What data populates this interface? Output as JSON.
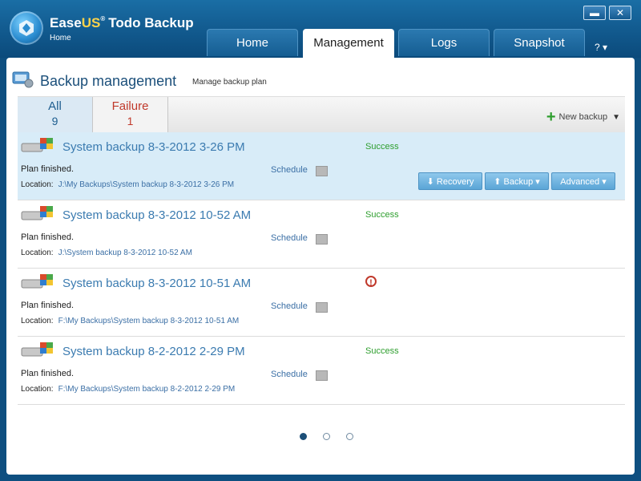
{
  "app": {
    "brand_ease": "Ease",
    "brand_us": "US",
    "brand_reg": "®",
    "brand_product": "Todo Backup",
    "home_label": "Home",
    "minimize_label": "▬",
    "close_label": "✕",
    "help_label": "? ▾"
  },
  "tabs": [
    {
      "label": "Home"
    },
    {
      "label": "Management"
    },
    {
      "label": "Logs"
    },
    {
      "label": "Snapshot"
    }
  ],
  "header": {
    "title": "Backup management",
    "subtitle": "Manage backup plan"
  },
  "filters": {
    "all_label": "All",
    "all_count": "9",
    "failure_label": "Failure",
    "failure_count": "1",
    "new_backup_label": "New backup"
  },
  "actions": {
    "recovery": "Recovery",
    "backup": "Backup",
    "advanced": "Advanced"
  },
  "backups": [
    {
      "name": "System backup 8-3-2012 3-26 PM",
      "status": "Success",
      "finished": "Plan finished.",
      "location_label": "Location:",
      "location": "J:\\My Backups\\System backup 8-3-2012 3-26 PM",
      "schedule": "Schedule",
      "selected": true
    },
    {
      "name": "System backup 8-3-2012 10-52 AM",
      "status": "Success",
      "finished": "Plan finished.",
      "location_label": "Location:",
      "location": "J:\\System backup 8-3-2012 10-52 AM",
      "schedule": "Schedule",
      "selected": false
    },
    {
      "name": "System backup 8-3-2012 10-51 AM",
      "status": "",
      "finished": "Plan finished.",
      "location_label": "Location:",
      "location": "F:\\My Backups\\System backup 8-3-2012 10-51 AM",
      "schedule": "Schedule",
      "selected": false
    },
    {
      "name": "System backup 8-2-2012 2-29 PM",
      "status": "Success",
      "finished": "Plan finished.",
      "location_label": "Location:",
      "location": "F:\\My Backups\\System backup 8-2-2012 2-29 PM",
      "schedule": "Schedule",
      "selected": false
    }
  ],
  "pagination": {
    "pages": 3,
    "current": 1
  },
  "colors": {
    "accent": "#1b4f7a",
    "success": "#2e9e2e",
    "failure": "#c0392b",
    "selected_row": "#d8ecf8"
  }
}
